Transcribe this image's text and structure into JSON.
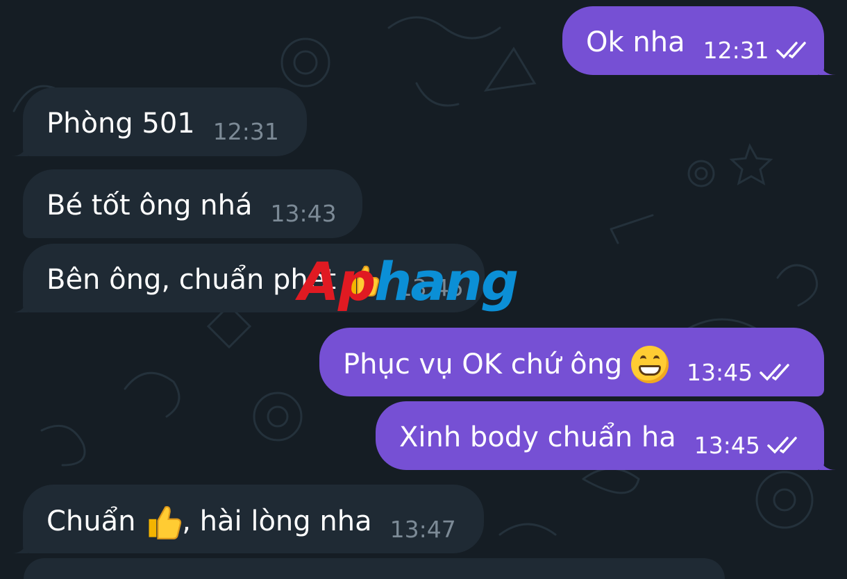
{
  "chat": {
    "messages": [
      {
        "direction": "outgoing",
        "text": "Ok nha",
        "time": "12:31",
        "status": "read"
      },
      {
        "direction": "incoming",
        "text": "Phòng 501",
        "time": "12:31"
      },
      {
        "direction": "incoming",
        "text": "Bé tốt ông nhá",
        "time": "13:43"
      },
      {
        "direction": "incoming",
        "text": "Bên ông, chuẩn phết",
        "emoji": "thumbs-up-icon",
        "time": "13:45"
      },
      {
        "direction": "outgoing",
        "text": "Phục vụ OK chứ ông",
        "emoji": "grinning-face-icon",
        "time": "13:45",
        "status": "read"
      },
      {
        "direction": "outgoing",
        "text": "Xinh body chuẩn ha",
        "time": "13:45",
        "status": "read"
      },
      {
        "direction": "incoming",
        "text_before": "Chuẩn",
        "emoji": "thumbs-up-icon",
        "text_after": ", hài lòng nha",
        "time": "13:47"
      }
    ]
  },
  "watermark": {
    "part1": "Ap",
    "part2": "hang"
  },
  "colors": {
    "background": "#151d24",
    "outgoing_bubble": "#7650d4",
    "incoming_bubble": "#1f2a34",
    "time_incoming": "#7c8a96",
    "watermark_red": "#e01a22",
    "watermark_blue": "#0b8fd6"
  }
}
